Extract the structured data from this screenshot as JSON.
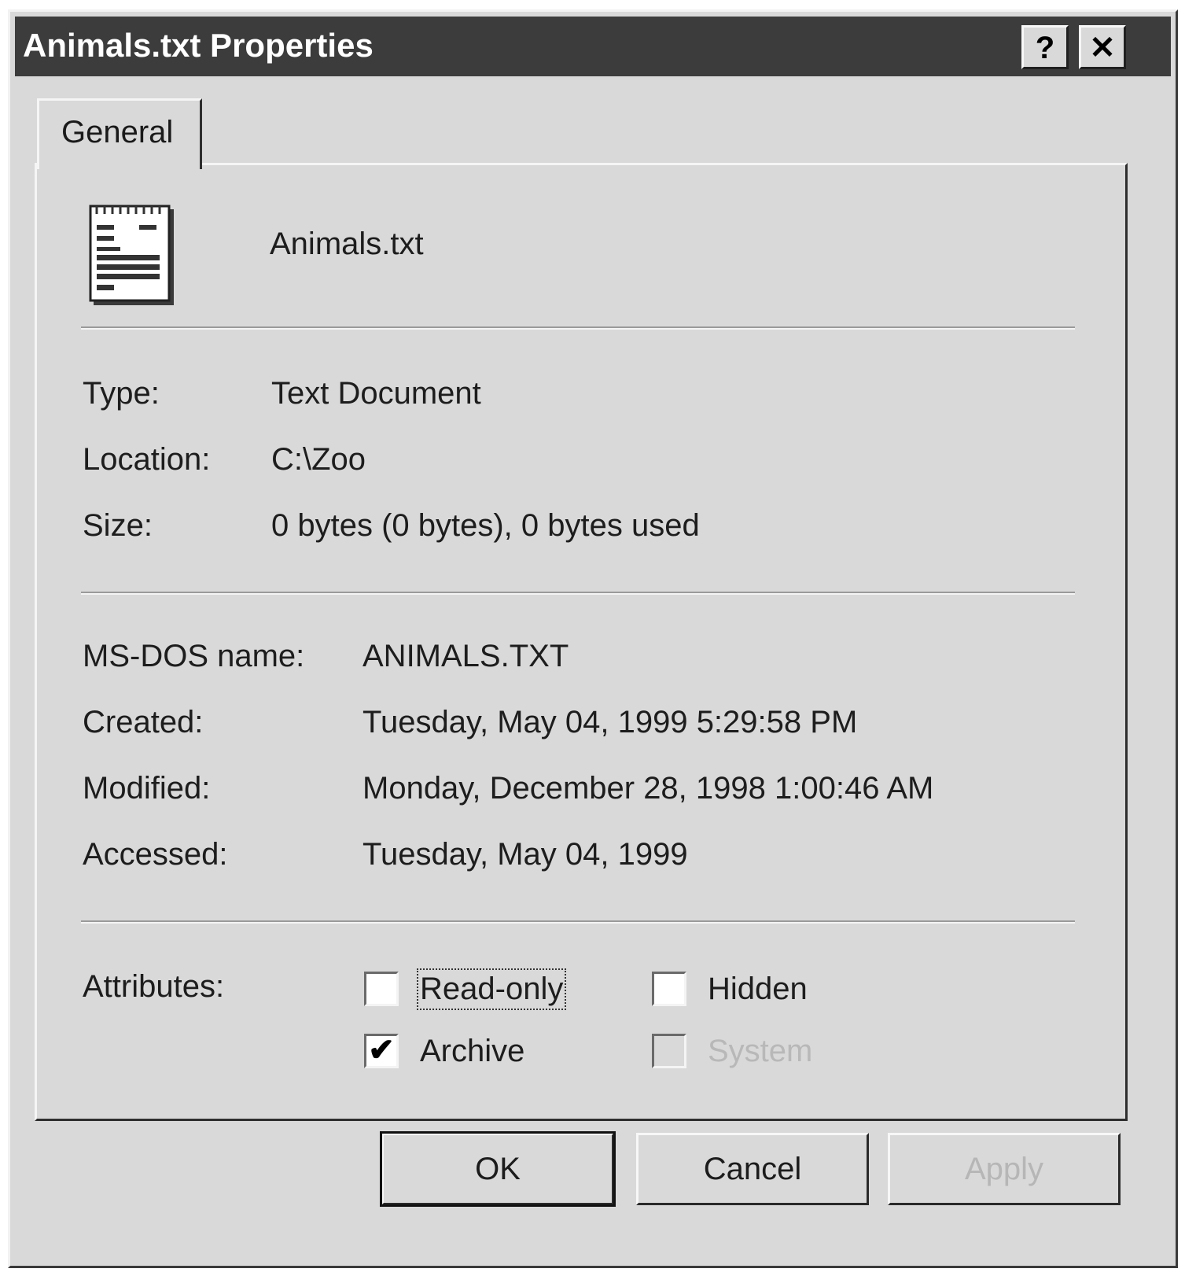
{
  "window": {
    "title": "Animals.txt Properties",
    "help_button": "?",
    "close_button": "✕"
  },
  "tabs": [
    {
      "label": "General"
    }
  ],
  "file": {
    "name": "Animals.txt",
    "icon": "notepad-text-document-icon"
  },
  "details": {
    "type_label": "Type:",
    "type_value": "Text Document",
    "location_label": "Location:",
    "location_value": "C:\\Zoo",
    "size_label": "Size:",
    "size_value": "0 bytes (0 bytes), 0 bytes used"
  },
  "dates": {
    "msdos_label": "MS-DOS name:",
    "msdos_value": "ANIMALS.TXT",
    "created_label": "Created:",
    "created_value": "Tuesday, May 04, 1999 5:29:58 PM",
    "modified_label": "Modified:",
    "modified_value": "Monday, December 28, 1998 1:00:46 AM",
    "accessed_label": "Accessed:",
    "accessed_value": "Tuesday, May 04, 1999"
  },
  "attributes": {
    "label": "Attributes:",
    "read_only": {
      "label": "Read-only",
      "checked": false
    },
    "archive": {
      "label": "Archive",
      "checked": true
    },
    "hidden": {
      "label": "Hidden",
      "checked": false
    },
    "system": {
      "label": "System",
      "checked": false,
      "disabled": true
    }
  },
  "buttons": {
    "ok": "OK",
    "cancel": "Cancel",
    "apply": "Apply"
  },
  "check_mark": "✔"
}
